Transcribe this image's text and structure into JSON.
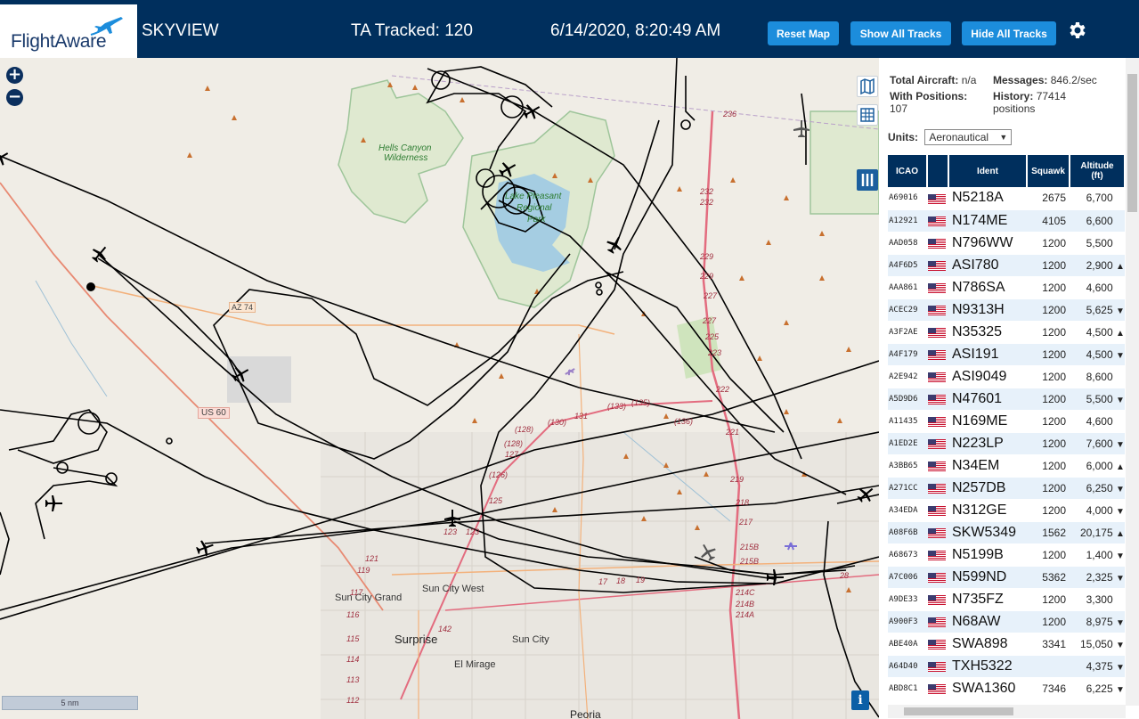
{
  "header": {
    "logo_text": "FlightAware",
    "app_title": "SKYVIEW",
    "ta_tracked": "TA Tracked: 120",
    "datetime": "6/14/2020, 8:20:49 AM",
    "reset_map_label": "Reset Map",
    "show_all_tracks_label": "Show All Tracks",
    "hide_all_tracks_label": "Hide All Tracks",
    "settings_icon": "gear-icon"
  },
  "map": {
    "labels": {
      "hells_canyon": "Hells Canyon",
      "wilderness": "Wilderness",
      "lake_pleasant_1": "Lake Pleasant",
      "lake_pleasant_2": "Regional",
      "lake_pleasant_3": "Park",
      "az74": "AZ 74",
      "us60": "US 60",
      "sun_city_grand": "Sun City Grand",
      "sun_city_west": "Sun City West",
      "surprise": "Surprise",
      "sun_city": "Sun City",
      "el_mirage": "El Mirage",
      "peoria": "Peoria"
    },
    "road_numbers": [
      "236",
      "232",
      "232",
      "229",
      "229",
      "227",
      "227",
      "225",
      "223",
      "222",
      "221",
      "219",
      "218",
      "217",
      "215B",
      "215B",
      "214C",
      "214B",
      "214A",
      "131",
      "(130)",
      "(128)",
      "(128)",
      "127",
      "(126)",
      "125",
      "123",
      "123",
      "121",
      "119",
      "117",
      "116",
      "115",
      "114",
      "113",
      "112",
      "(133)",
      "(135)",
      "(136)",
      "142",
      "17",
      "18",
      "19",
      "28"
    ],
    "scale_label": "5 nm",
    "info_label": "i",
    "colors": {
      "water": "#a5cde2",
      "park": "#d4e8c7",
      "park_border": "#9ec59a",
      "road_major": "#e36c7f",
      "road_minor": "#f3b17b",
      "track": "#000000"
    }
  },
  "stats": {
    "total_aircraft_label": "Total Aircraft:",
    "total_aircraft_value": "n/a",
    "messages_label": "Messages:",
    "messages_value": "846.2/sec",
    "with_positions_label": "With Positions:",
    "with_positions_value": "107",
    "history_label": "History:",
    "history_value": "77414",
    "history_unit": "positions"
  },
  "units": {
    "label": "Units:",
    "selected": "Aeronautical"
  },
  "table": {
    "headers": {
      "icao": "ICAO",
      "ident": "Ident",
      "squawk": "Squawk",
      "altitude": "Altitude",
      "altitude_unit": "(ft)"
    },
    "rows": [
      {
        "icao": "A69016",
        "ident": "N5218A",
        "squawk": "2675",
        "alt": "6,700",
        "trend": ""
      },
      {
        "icao": "A12921",
        "ident": "N174ME",
        "squawk": "4105",
        "alt": "6,600",
        "trend": ""
      },
      {
        "icao": "AAD058",
        "ident": "N796WW",
        "squawk": "1200",
        "alt": "5,500",
        "trend": ""
      },
      {
        "icao": "A4F6D5",
        "ident": "ASI780",
        "squawk": "1200",
        "alt": "2,900",
        "trend": "▲"
      },
      {
        "icao": "AAA861",
        "ident": "N786SA",
        "squawk": "1200",
        "alt": "4,600",
        "trend": ""
      },
      {
        "icao": "ACEC29",
        "ident": "N9313H",
        "squawk": "1200",
        "alt": "5,625",
        "trend": "▼"
      },
      {
        "icao": "A3F2AE",
        "ident": "N35325",
        "squawk": "1200",
        "alt": "4,500",
        "trend": "▲"
      },
      {
        "icao": "A4F179",
        "ident": "ASI191",
        "squawk": "1200",
        "alt": "4,500",
        "trend": "▼"
      },
      {
        "icao": "A2E942",
        "ident": "ASI9049",
        "squawk": "1200",
        "alt": "8,600",
        "trend": ""
      },
      {
        "icao": "A5D9D6",
        "ident": "N47601",
        "squawk": "1200",
        "alt": "5,500",
        "trend": "▼"
      },
      {
        "icao": "A11435",
        "ident": "N169ME",
        "squawk": "1200",
        "alt": "4,600",
        "trend": ""
      },
      {
        "icao": "A1ED2E",
        "ident": "N223LP",
        "squawk": "1200",
        "alt": "7,600",
        "trend": "▼"
      },
      {
        "icao": "A3BB65",
        "ident": "N34EM",
        "squawk": "1200",
        "alt": "6,000",
        "trend": "▲"
      },
      {
        "icao": "A271CC",
        "ident": "N257DB",
        "squawk": "1200",
        "alt": "6,250",
        "trend": "▼"
      },
      {
        "icao": "A34EDA",
        "ident": "N312GE",
        "squawk": "1200",
        "alt": "4,000",
        "trend": "▼"
      },
      {
        "icao": "A08F6B",
        "ident": "SKW5349",
        "squawk": "1562",
        "alt": "20,175",
        "trend": "▲"
      },
      {
        "icao": "A68673",
        "ident": "N5199B",
        "squawk": "1200",
        "alt": "1,400",
        "trend": "▼"
      },
      {
        "icao": "A7C006",
        "ident": "N599ND",
        "squawk": "5362",
        "alt": "2,325",
        "trend": "▼"
      },
      {
        "icao": "A9DE33",
        "ident": "N735FZ",
        "squawk": "1200",
        "alt": "3,300",
        "trend": ""
      },
      {
        "icao": "A900F3",
        "ident": "N68AW",
        "squawk": "1200",
        "alt": "8,975",
        "trend": "▼"
      },
      {
        "icao": "ABE40A",
        "ident": "SWA898",
        "squawk": "3341",
        "alt": "15,050",
        "trend": "▼"
      },
      {
        "icao": "A64D40",
        "ident": "TXH5322",
        "squawk": "",
        "alt": "4,375",
        "trend": "▼"
      },
      {
        "icao": "ABD8C1",
        "ident": "SWA1360",
        "squawk": "7346",
        "alt": "6,225",
        "trend": "▼"
      }
    ]
  }
}
